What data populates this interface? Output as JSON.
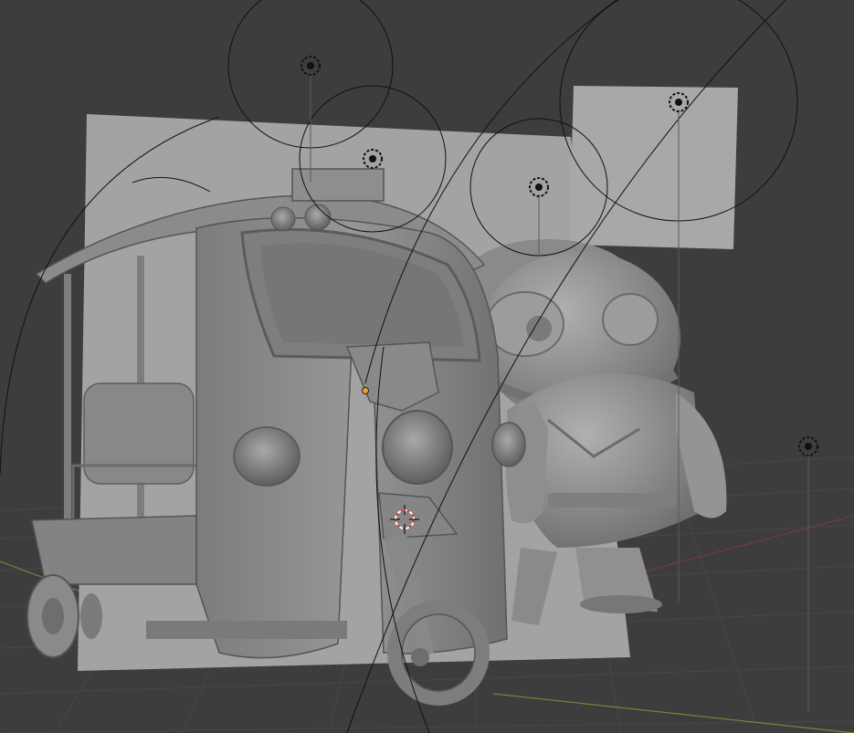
{
  "viewport": {
    "mode": "solid-shading",
    "background_color": "#3d3d3d",
    "grid_color": "#454545",
    "x_axis_color": "#8a3a3a",
    "y_axis_color": "#6f8a3a",
    "model_color": "#8c8c8c",
    "backdrop_color": "#9a9a9a"
  },
  "objects": [
    {
      "name": "tuk-tuk-vehicle",
      "kind": "mesh"
    },
    {
      "name": "character-figure",
      "kind": "mesh"
    },
    {
      "name": "backdrop-plane-main",
      "kind": "mesh"
    },
    {
      "name": "backdrop-plane-upper-right",
      "kind": "mesh"
    }
  ],
  "lights": [
    {
      "name": "light-1",
      "type": "point"
    },
    {
      "name": "light-2",
      "type": "point"
    },
    {
      "name": "light-3",
      "type": "point"
    },
    {
      "name": "light-4",
      "type": "point"
    },
    {
      "name": "light-5",
      "type": "point"
    }
  ],
  "icons": {
    "light": "light-point-icon",
    "cursor": "3d-cursor-icon",
    "origin": "object-origin-icon"
  }
}
